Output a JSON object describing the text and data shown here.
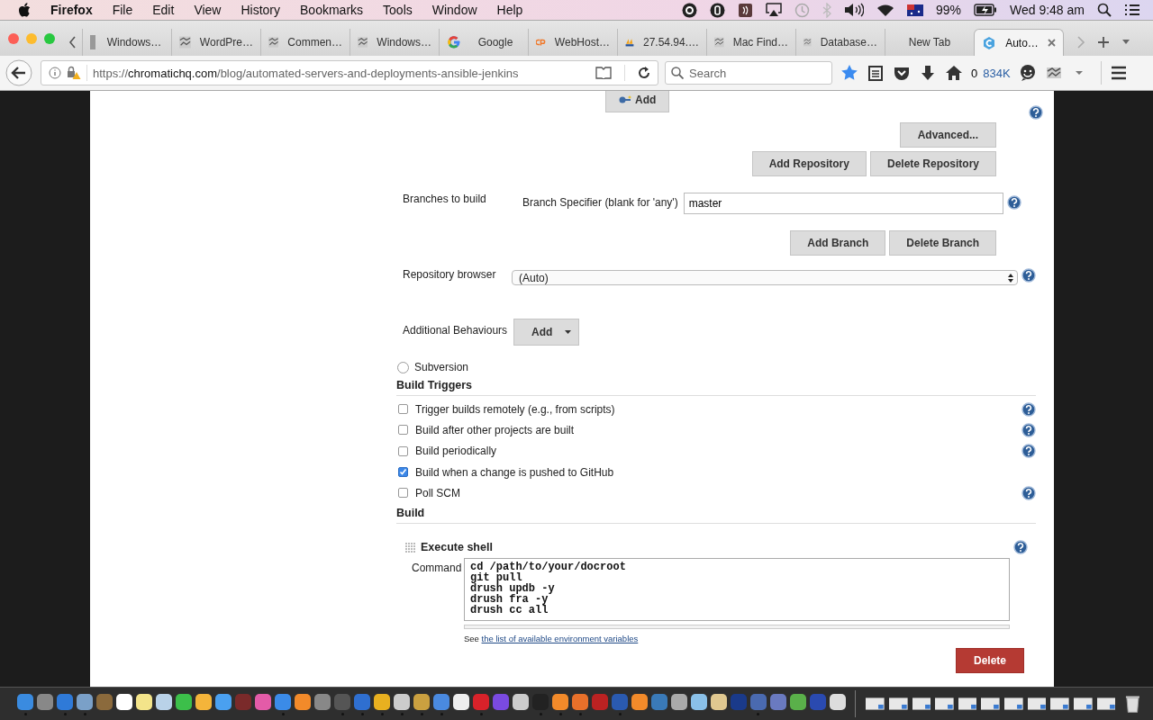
{
  "menu_bar": {
    "app": "Firefox",
    "items": [
      "File",
      "Edit",
      "View",
      "History",
      "Bookmarks",
      "Tools",
      "Window",
      "Help"
    ],
    "battery": "99%",
    "clock": "Wed 9:48 am"
  },
  "tabs": [
    {
      "label": "Windows…",
      "kind": "partial",
      "selected": false
    },
    {
      "label": "WordPre…",
      "kind": "generic",
      "selected": false
    },
    {
      "label": "Commen…",
      "kind": "generic",
      "selected": false
    },
    {
      "label": "Windows…",
      "kind": "generic",
      "selected": false
    },
    {
      "label": "Google",
      "kind": "google",
      "selected": false
    },
    {
      "label": "WebHost…",
      "kind": "cpanel",
      "selected": false
    },
    {
      "label": "27.54.94.…",
      "kind": "pma",
      "selected": false
    },
    {
      "label": "Mac Find…",
      "kind": "generic",
      "selected": false
    },
    {
      "label": "Database…",
      "kind": "generic",
      "selected": false
    },
    {
      "label": "New Tab",
      "kind": "none",
      "selected": false
    },
    {
      "label": "Auto…",
      "kind": "chromatic",
      "selected": true
    }
  ],
  "nav_bar": {
    "url_scheme": "https://",
    "url_host": "chromatichq.com",
    "url_path": "/blog/automated-servers-and-deployments-ansible-jenkins",
    "search_placeholder": "Search",
    "counter": "0",
    "download_size": "834K"
  },
  "form": {
    "credentials_add": "Add",
    "advanced": "Advanced...",
    "add_repository": "Add Repository",
    "delete_repository": "Delete Repository",
    "branches_label": "Branches to build",
    "branch_specifier_label": "Branch Specifier (blank for 'any')",
    "branch_specifier": "master",
    "add_branch": "Add Branch",
    "delete_branch": "Delete Branch",
    "repository_browser_label": "Repository browser",
    "repository_browser": "(Auto)",
    "behaviours_label": "Additional Behaviours",
    "behaviours_add": "Add",
    "subversion": {
      "label": "Subversion",
      "selected": false
    },
    "build_triggers": {
      "title": "Build Triggers",
      "items": [
        {
          "label": "Trigger builds remotely (e.g., from scripts)",
          "checked": false,
          "help": true
        },
        {
          "label": "Build after other projects are built",
          "checked": false,
          "help": true
        },
        {
          "label": "Build periodically",
          "checked": false,
          "help": true
        },
        {
          "label": "Build when a change is pushed to GitHub",
          "checked": true,
          "help": false
        },
        {
          "label": "Poll SCM",
          "checked": false,
          "help": true
        }
      ]
    },
    "build": {
      "title": "Build",
      "step_title": "Execute shell",
      "command_label": "Command",
      "command": "cd /path/to/your/docroot\ngit pull\ndrush updb -y\ndrush fra -y\ndrush cc all",
      "hint": "See",
      "hint_link": "the list of available environment variables",
      "delete": "Delete"
    }
  },
  "dock": [
    {
      "running": true
    },
    {
      "running": false
    },
    {
      "running": true
    },
    {
      "running": true
    },
    {
      "running": false
    },
    {
      "running": false
    },
    {
      "running": false
    },
    {
      "running": false
    },
    {
      "running": false
    },
    {
      "running": false
    },
    {
      "running": false
    },
    {
      "running": false
    },
    {
      "running": false
    },
    {
      "running": true
    },
    {
      "running": false
    },
    {
      "running": false
    },
    {
      "running": true
    },
    {
      "running": true
    },
    {
      "running": true
    },
    {
      "running": true
    },
    {
      "running": true
    },
    {
      "running": true
    },
    {
      "running": false
    },
    {
      "running": true
    },
    {
      "running": false
    },
    {
      "running": false
    },
    {
      "running": true
    },
    {
      "running": true
    },
    {
      "running": true
    },
    {
      "running": false
    },
    {
      "running": true
    },
    {
      "running": false
    },
    {
      "running": false
    },
    {
      "running": false
    },
    {
      "running": false
    },
    {
      "running": false
    },
    {
      "running": false
    },
    {
      "running": true
    },
    {
      "running": false
    },
    {
      "running": false
    },
    {
      "running": false
    },
    {
      "running": false
    }
  ]
}
